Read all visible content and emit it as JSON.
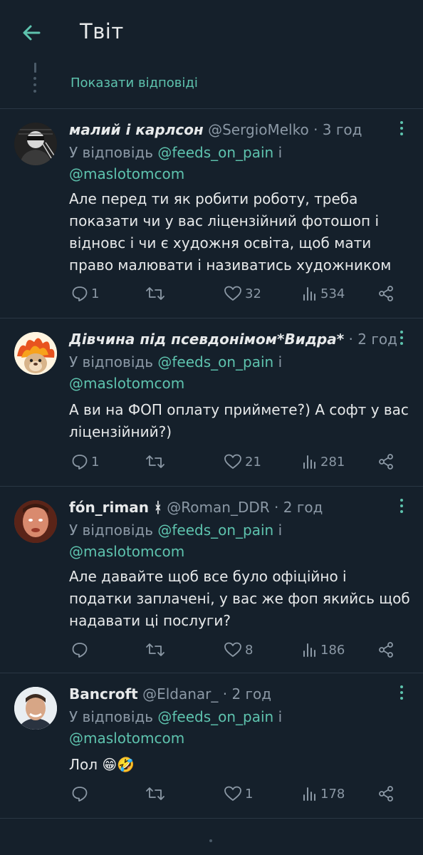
{
  "header": {
    "title": "Твіт",
    "back_icon": "arrow-left-icon"
  },
  "thread": {
    "show_replies": "Показати відповіді"
  },
  "colors": {
    "background": "#15202b",
    "accent": "#5ec3ae",
    "muted": "#8b98a5",
    "text": "#e7e9ea",
    "divider": "#2a3744"
  },
  "tweets": [
    {
      "name": "малий і карлсон",
      "handle": "@SergioMelko",
      "sep": "·",
      "time": "3 год",
      "reply_prefix": "У відповідь",
      "mention1": "@feeds_on_pain",
      "conj": "і",
      "mention2": "@maslotomcom",
      "text": "Але перед ти як робити роботу, треба показати чи у вас ліцензійний фотошоп і віднов​с і чи є художня освіта, щоб мати право малювати і називатись художником",
      "replies": "1",
      "retweets": "",
      "likes": "32",
      "views": "534"
    },
    {
      "name": "Дівчина під псевдонімом*Видра*",
      "handle": "",
      "sep": "·",
      "time": "2 год",
      "reply_prefix": "У відповідь",
      "mention1": "@feeds_on_pain",
      "conj": "і",
      "mention2": "@maslotomcom",
      "text": "А ви на ФОП оплату приймете?) А софт у вас ліцензійний?)",
      "replies": "1",
      "retweets": "",
      "likes": "21",
      "views": "281"
    },
    {
      "name": "fón_riman ᚼ",
      "handle": "@Roman_DDR",
      "sep": "·",
      "time": "2 год",
      "reply_prefix": "У відповідь",
      "mention1": "@feeds_on_pain",
      "conj": "і",
      "mention2": "@maslotomcom",
      "text": "Але давайте щоб все було офіційно і податки заплачені, у вас же фоп якийсь щоб надавати ці послуги?",
      "replies": "",
      "retweets": "",
      "likes": "8",
      "views": "186"
    },
    {
      "name": "Bancroft",
      "handle": "@Eldanar_",
      "sep": "·",
      "time": "2 год",
      "reply_prefix": "У відповідь",
      "mention1": "@feeds_on_pain",
      "conj": "і",
      "mention2": "@maslotomcom",
      "text": "Лол 😁🤣",
      "replies": "",
      "retweets": "",
      "likes": "1",
      "views": "178"
    }
  ],
  "icons": {
    "reply": "reply-icon",
    "retweet": "retweet-icon",
    "like": "heart-icon",
    "views": "views-icon",
    "share": "share-icon",
    "more": "more-vertical-icon"
  }
}
